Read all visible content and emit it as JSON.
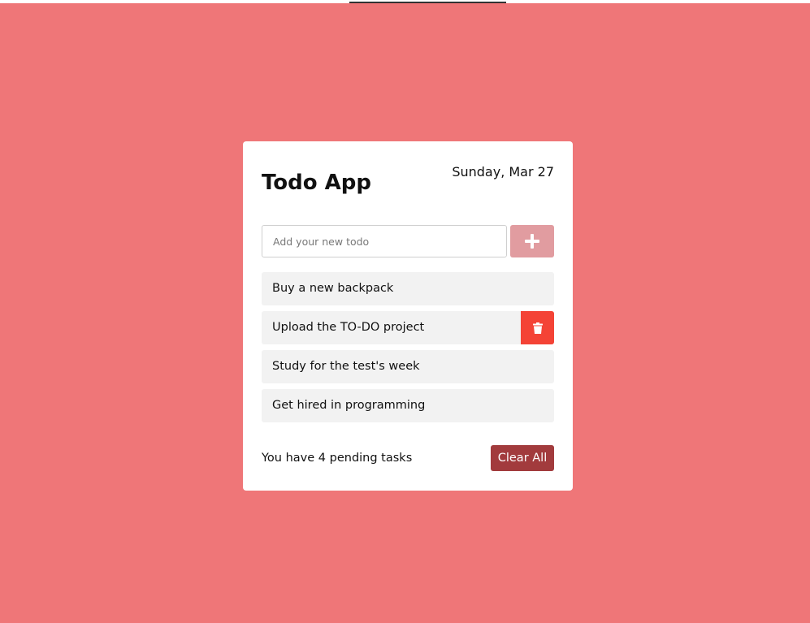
{
  "colors": {
    "background": "#ef7678",
    "card": "#ffffff",
    "add_button": "#e19ca0",
    "delete_button": "#f44336",
    "clear_button": "#a23b3d",
    "todo_item": "#f2f2f2"
  },
  "header": {
    "title": "Todo App",
    "date": "Sunday, Mar 27"
  },
  "input": {
    "placeholder": "Add your new todo",
    "value": "",
    "add_icon": "plus-icon"
  },
  "todos": [
    {
      "text": "Buy a new backpack"
    },
    {
      "text": "Upload the TO-DO project",
      "delete_icon": "trash-icon"
    },
    {
      "text": "Study for the test's week"
    },
    {
      "text": "Get hired in programming"
    }
  ],
  "footer": {
    "pending_text": "You have 4 pending tasks",
    "clear_label": "Clear All"
  }
}
